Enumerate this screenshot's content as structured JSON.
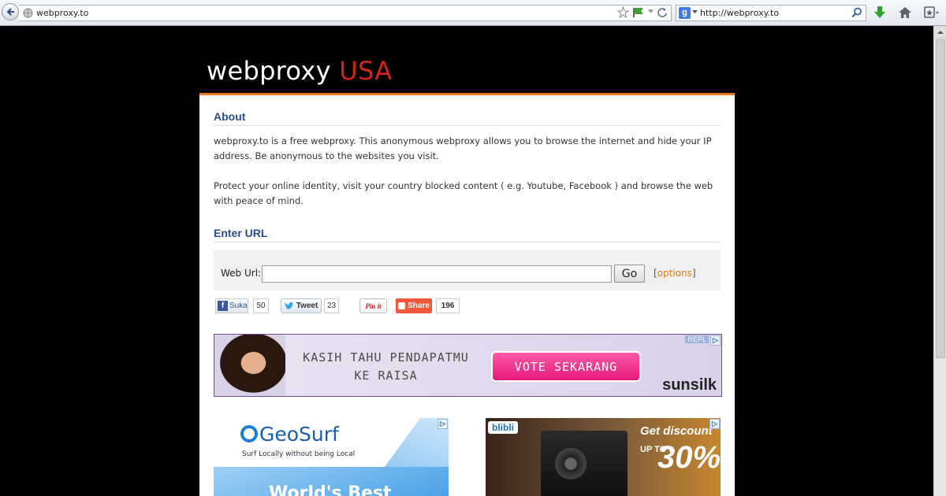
{
  "browser": {
    "address": "webproxy.to",
    "search_value": "http://webproxy.to",
    "search_engine_letter": "g"
  },
  "site": {
    "logo_main": "webproxy ",
    "logo_accent": "USA"
  },
  "about": {
    "title": "About",
    "para1": "webproxy.to is a free webproxy. This anonymous webproxy allows you to browse the internet and hide your IP address. Be anonymous to the websites you visit.",
    "para2": "Protect your online identity, visit your country blocked content ( e.g. Youtube, Facebook ) and browse the web with peace of mind."
  },
  "enter_url": {
    "title": "Enter URL",
    "label": "Web Url:",
    "value": "",
    "go_label": "Go",
    "options_open": "[",
    "options_label": "options",
    "options_close": "]"
  },
  "social": {
    "fb_label": "Suka",
    "fb_count": "50",
    "tweet_label": "Tweet",
    "tweet_count": "23",
    "pin_label": "Pin it",
    "share_label": "Share",
    "share_count": "196"
  },
  "banner_ad": {
    "line1": "KASIH TAHU PENDAPATMU",
    "line2": "KE RAISA",
    "cta": "VOTE SEKARANG",
    "brand": "sunsilk",
    "tag": "REPL"
  },
  "ad_geosurf": {
    "logo": "GeoSurf",
    "tagline": "Surf Locally without being Local",
    "headline": "World's Best"
  },
  "ad_blibli": {
    "logo": "blibli",
    "headline": "Get discount",
    "upto": "UP TO »",
    "percent": "30%"
  },
  "colors": {
    "accent_orange": "#e8761d",
    "accent_red": "#d0241c",
    "heading_blue": "#2a4d8b"
  }
}
